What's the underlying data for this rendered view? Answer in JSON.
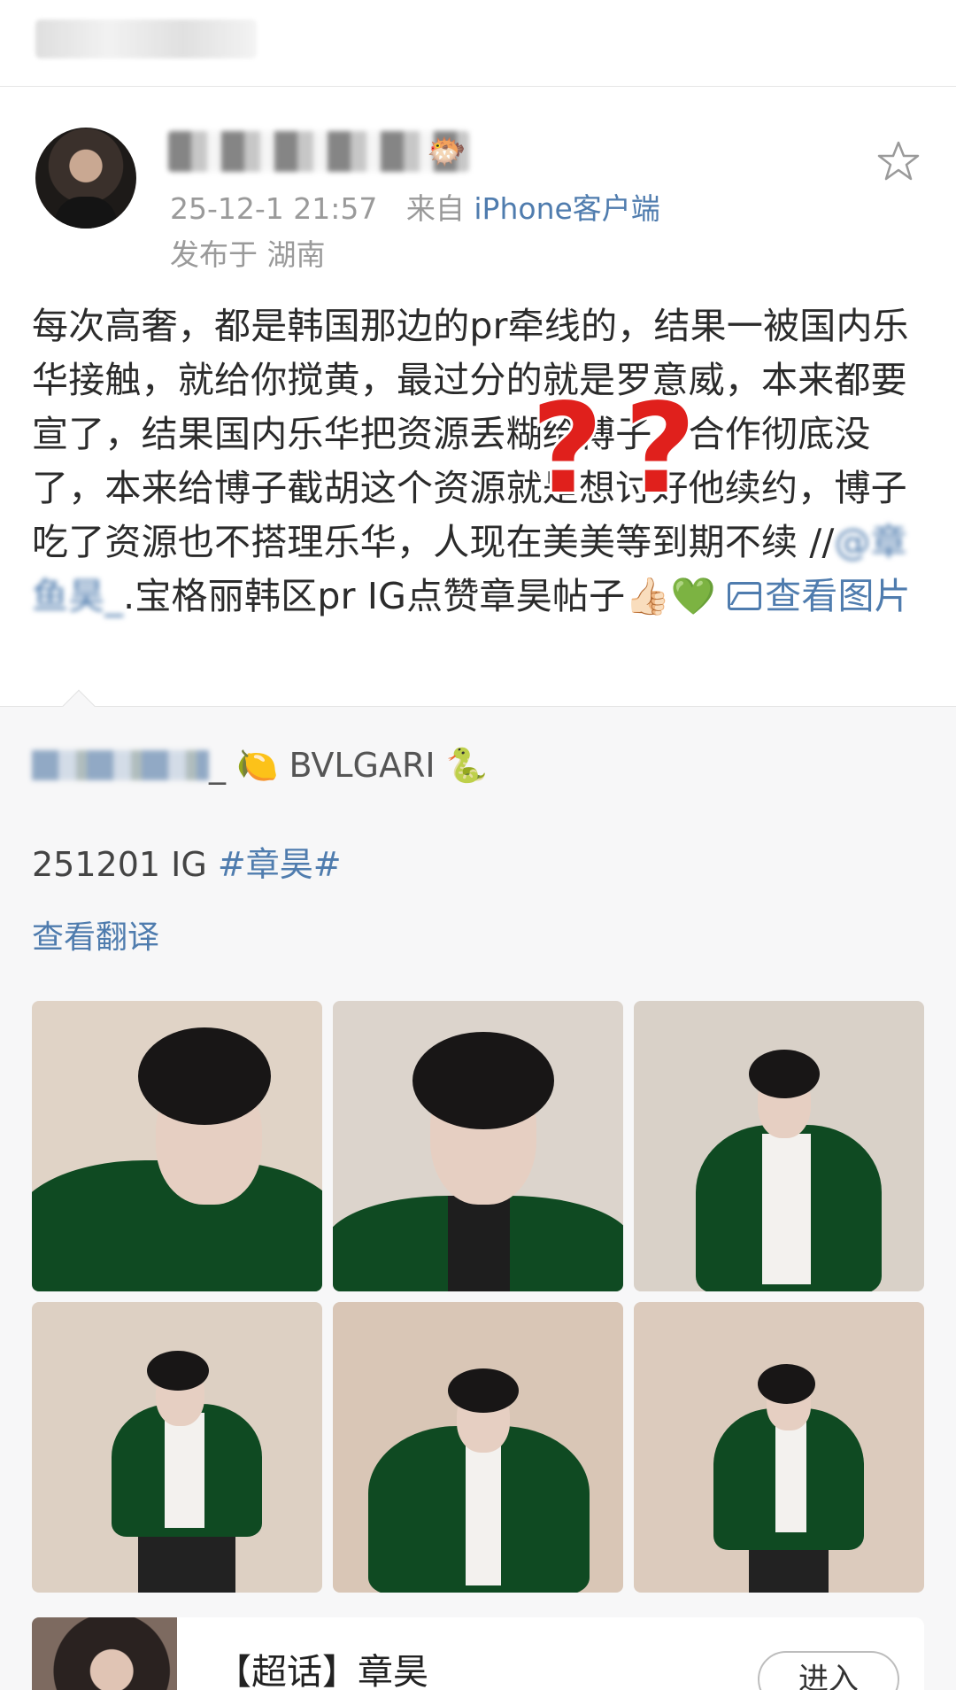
{
  "post": {
    "meta_time": "25-12-1 21:57",
    "meta_source": "来自",
    "meta_client": "iPhone客户端",
    "location": "发布于 湖南",
    "body_main": "每次高奢，都是韩国那边的pr牵线的，结果一被国内乐华接触，就给你搅黄，最过分的就是罗意威，本来都要宣了，结果国内乐华把资源丢糊给博子，合作彻底没了，本来给博子截胡这个资源就是想讨好他续约，博子吃了资源也不搭理乐华，人现在美美等到期不续 //",
    "body_mention": "@章鱼昊_",
    "body_tail": ".宝格丽韩区pr IG点赞章昊帖子👍🏻💚",
    "view_image": "查看图片"
  },
  "user_emoji": "🐡",
  "repost": {
    "user_suffix": "_",
    "user_text": "🍋 BVLGARI 🐍",
    "text_prefix": "251201 IG ",
    "text_tag": "#章昊#",
    "translate": "查看翻译"
  },
  "photos": [
    {
      "pose": "closeup-hand"
    },
    {
      "pose": "portrait"
    },
    {
      "pose": "standing"
    },
    {
      "pose": "standing"
    },
    {
      "pose": "hand-chin"
    },
    {
      "pose": "hand-chin"
    }
  ],
  "topic": {
    "title": "【超话】章昊",
    "enter": "进入"
  },
  "colors": {
    "link": "#4f7cae",
    "meta": "#9a9a9a",
    "repost_bg": "#f7f7f8",
    "question_mark": "#e0201c"
  },
  "icons": [
    "star-icon",
    "picture-icon",
    "question-mark-icon"
  ]
}
